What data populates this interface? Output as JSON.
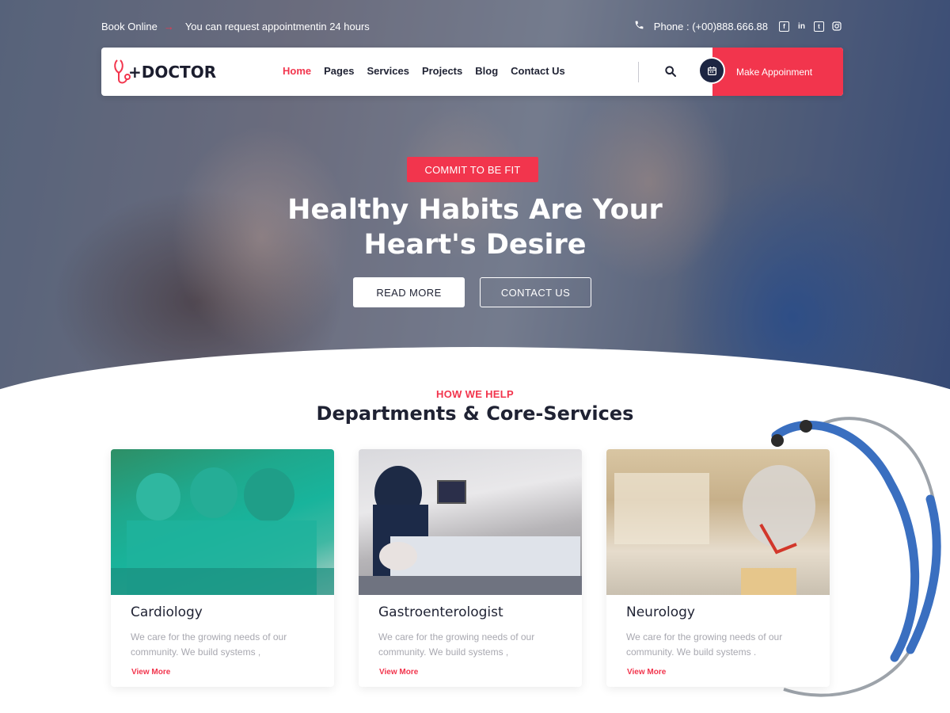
{
  "topbar": {
    "book_online": "Book Online",
    "arrow": "→",
    "request_text": "You can request appointmentin 24 hours",
    "phone": "Phone : (+00)888.666.88",
    "social": [
      "facebook",
      "linkedin",
      "twitter",
      "instagram"
    ]
  },
  "nav": {
    "logo_text": "DOCTOR",
    "logo_prefix": "+",
    "menu": [
      "Home",
      "Pages",
      "Services",
      "Projects",
      "Blog",
      "Contact Us"
    ],
    "active": "Home",
    "appointment_label": "Make Appoinment"
  },
  "hero": {
    "badge": "COMMIT TO BE FIT",
    "title_line1": "Healthy Habits Are Your",
    "title_line2": "Heart's Desire",
    "read_more": "READ MORE",
    "contact_us": "CONTACT US"
  },
  "section": {
    "eyebrow": "HOW WE HELP",
    "title": "Departments & Core-Services"
  },
  "cards": [
    {
      "title": "Cardiology",
      "text": "We care for the growing needs of our community. We build systems ,",
      "link": "View More"
    },
    {
      "title": "Gastroenterologist",
      "text": "We care for the growing needs of our community. We build systems ,",
      "link": "View More"
    },
    {
      "title": "Neurology",
      "text": "We care for the growing needs of our community. We build systems .",
      "link": "View More"
    }
  ],
  "colors": {
    "accent": "#f2354d",
    "dark": "#1c2542",
    "text": "#1f2233",
    "muted": "#a8a8b0"
  }
}
